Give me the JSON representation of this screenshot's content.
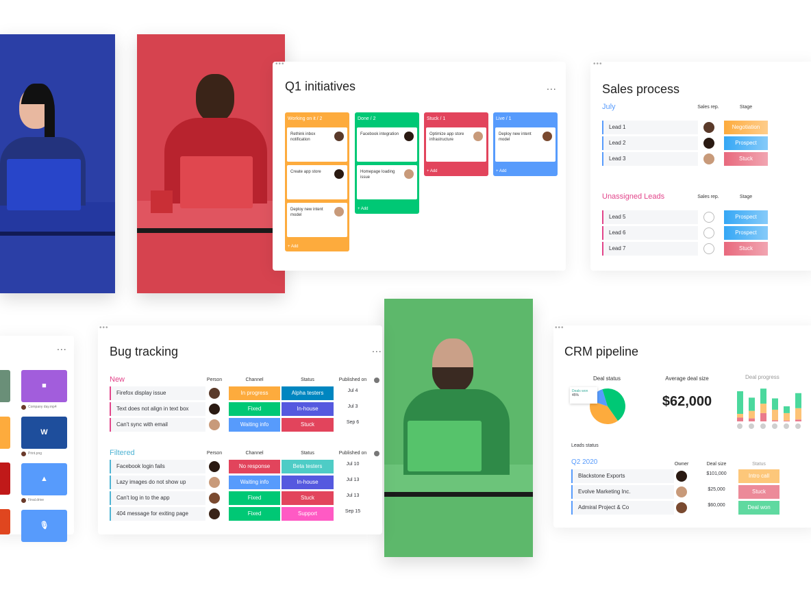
{
  "colors": {
    "orange": "#fdab3d",
    "green": "#00c875",
    "red": "#e2445c",
    "blue": "#579bfc",
    "purple": "#a25ddc",
    "pink": "#e2448a",
    "darkblue": "#0086c0",
    "indigo": "#5559df",
    "teal": "#4eccc6",
    "magenta": "#ff5ac4"
  },
  "q1": {
    "title": "Q1 initiatives",
    "menu": "...",
    "add_label": "+ Add",
    "columns": [
      {
        "title": "Working on it / 2",
        "color": "#fdab3d",
        "cards": [
          "Rethink inbox notification",
          "Create app store",
          "Deploy new intent model"
        ]
      },
      {
        "title": "Done / 2",
        "color": "#00c875",
        "cards": [
          "Facebook integration",
          "Homepage loading issue"
        ]
      },
      {
        "title": "Stuck / 1",
        "color": "#e2445c",
        "cards": [
          "Optimize app store infrastructure"
        ]
      },
      {
        "title": "Live / 1",
        "color": "#579bfc",
        "cards": [
          "Deploy new intent model"
        ]
      }
    ]
  },
  "sales": {
    "title": "Sales process",
    "col_rep": "Sales rep.",
    "col_stage": "Stage",
    "groups": [
      {
        "name": "July",
        "color": "#579bfc",
        "rows": [
          {
            "name": "Lead 1",
            "stage": "Negotiation",
            "color": "#fdab3d"
          },
          {
            "name": "Lead 2",
            "stage": "Prospect",
            "color": "#35a7f5"
          },
          {
            "name": "Lead 3",
            "stage": "Stuck",
            "color": "#e8697d"
          }
        ]
      },
      {
        "name": "Unassigned Leads",
        "color": "#e2448a",
        "rows": [
          {
            "name": "Lead 5",
            "stage": "Prospect",
            "color": "#35a7f5"
          },
          {
            "name": "Lead 6",
            "stage": "Prospect",
            "color": "#35a7f5"
          },
          {
            "name": "Lead 7",
            "stage": "Stuck",
            "color": "#e8697d"
          }
        ]
      }
    ]
  },
  "files": {
    "menu": "...",
    "items": [
      {
        "caption": "Company day.mp4",
        "label": "",
        "icon": "video-camera-icon",
        "color": "#a25ddc"
      },
      {
        "caption": "Print.png",
        "label": "W",
        "icon": "word-icon",
        "color": "#1e4e9c"
      },
      {
        "caption": "Final.drive",
        "label": "",
        "icon": "google-drive-icon",
        "color": "#579bfc"
      },
      {
        "caption": "",
        "label": "",
        "icon": "microphone-icon",
        "color": "#579bfc"
      }
    ]
  },
  "bugs": {
    "title": "Bug tracking",
    "menu": "...",
    "cols": {
      "person": "Person",
      "channel": "Channel",
      "status": "Status",
      "published": "Published on"
    },
    "groups": [
      {
        "name": "New",
        "color": "#e2448a",
        "rows": [
          {
            "name": "Firefox display issue",
            "channel": "In progress",
            "cc": "#fdab3d",
            "status": "Alpha testers",
            "sc": "#0086c0",
            "date": "Jul 4"
          },
          {
            "name": "Text does not align in text box",
            "channel": "Fixed",
            "cc": "#00c875",
            "status": "In-house",
            "sc": "#5559df",
            "date": "Jul 3"
          },
          {
            "name": "Can't sync with email",
            "channel": "Waiting  info",
            "cc": "#579bfc",
            "status": "Stuck",
            "sc": "#e2445c",
            "date": "Sep 6"
          }
        ]
      },
      {
        "name": "Filtered",
        "color": "#4eb3d3",
        "rows": [
          {
            "name": "Facebook login fails",
            "channel": "No response",
            "cc": "#e2445c",
            "status": "Beta testers",
            "sc": "#4eccc6",
            "date": "Jul 10"
          },
          {
            "name": "Lazy images do not show up",
            "channel": "Waiting  info",
            "cc": "#579bfc",
            "status": "In-house",
            "sc": "#5559df",
            "date": "Jul 13"
          },
          {
            "name": "Can't log in to the app",
            "channel": "Fixed",
            "cc": "#00c875",
            "status": "Stuck",
            "sc": "#e2445c",
            "date": "Jul 13"
          },
          {
            "name": "404 message for exiting page",
            "channel": "Fixed",
            "cc": "#00c875",
            "status": "Support",
            "sc": "#ff5ac4",
            "date": "Sep 15"
          }
        ]
      }
    ]
  },
  "crm": {
    "title": "CRM pipeline",
    "deal_status": "Deal status",
    "deal_won_label": "Deals won",
    "deal_won_pct": "45%",
    "pie": [
      {
        "label": "Deals won",
        "value": 45,
        "color": "#00c875"
      },
      {
        "label": "",
        "value": 40,
        "color": "#fdab3d"
      },
      {
        "label": "",
        "value": 15,
        "color": "#579bfc"
      }
    ],
    "avg_label": "Average deal size",
    "avg_value": "$62,000",
    "progress_label": "Deal progress",
    "leads_status": "Leads status",
    "group": "Q2 2020",
    "cols": {
      "owner": "Owner",
      "size": "Deal size",
      "status": "Status"
    },
    "rows": [
      {
        "name": "Blackstone Exports",
        "size": "$101,000",
        "status": "Intro call",
        "color": "#fdc77a"
      },
      {
        "name": "Evolve Marketing Inc.",
        "size": "$25,000",
        "status": "Stuck",
        "color": "#ec8a99"
      },
      {
        "name": "Admiral Project & Co",
        "size": "$60,000",
        "status": "Deal won",
        "color": "#5fd9a0"
      }
    ]
  }
}
